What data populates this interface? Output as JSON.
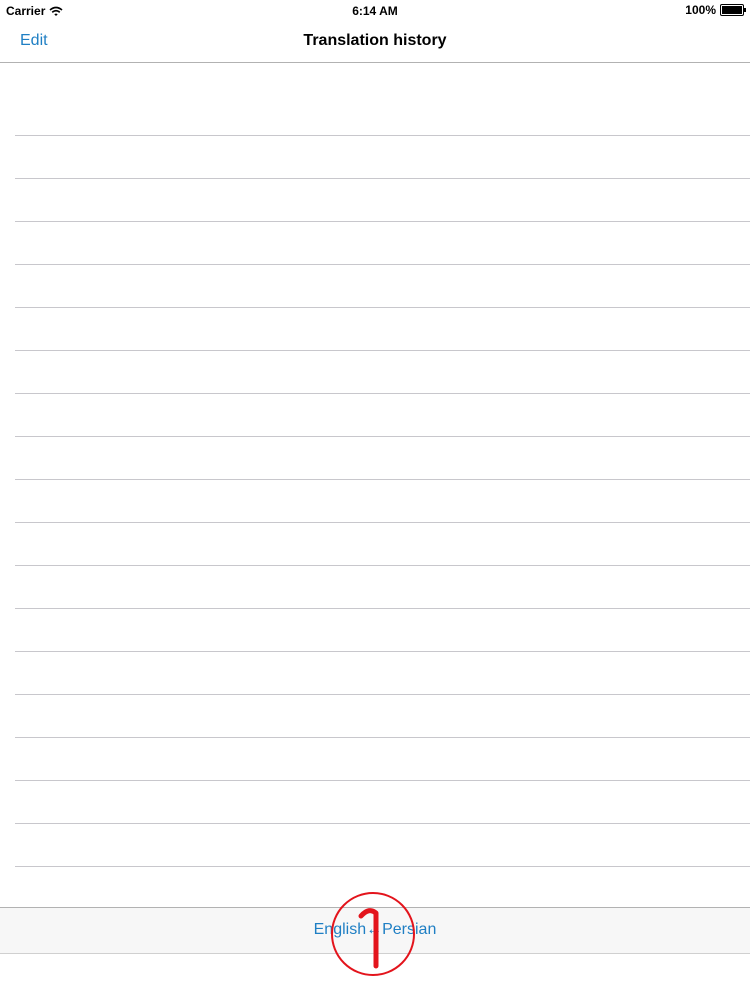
{
  "status_bar": {
    "carrier": "Carrier",
    "time": "6:14 AM",
    "battery": "100%"
  },
  "nav": {
    "edit_label": "Edit",
    "title": "Translation history"
  },
  "table": {
    "row_count": 18,
    "rows": []
  },
  "toolbar": {
    "language_pair": "English↔Persian"
  },
  "annotation": {
    "number": "1",
    "color": "#e3141c"
  },
  "colors": {
    "accent": "#1f7fc4",
    "separator": "#c8c7cc",
    "toolbar_bg": "#f7f7f7"
  }
}
